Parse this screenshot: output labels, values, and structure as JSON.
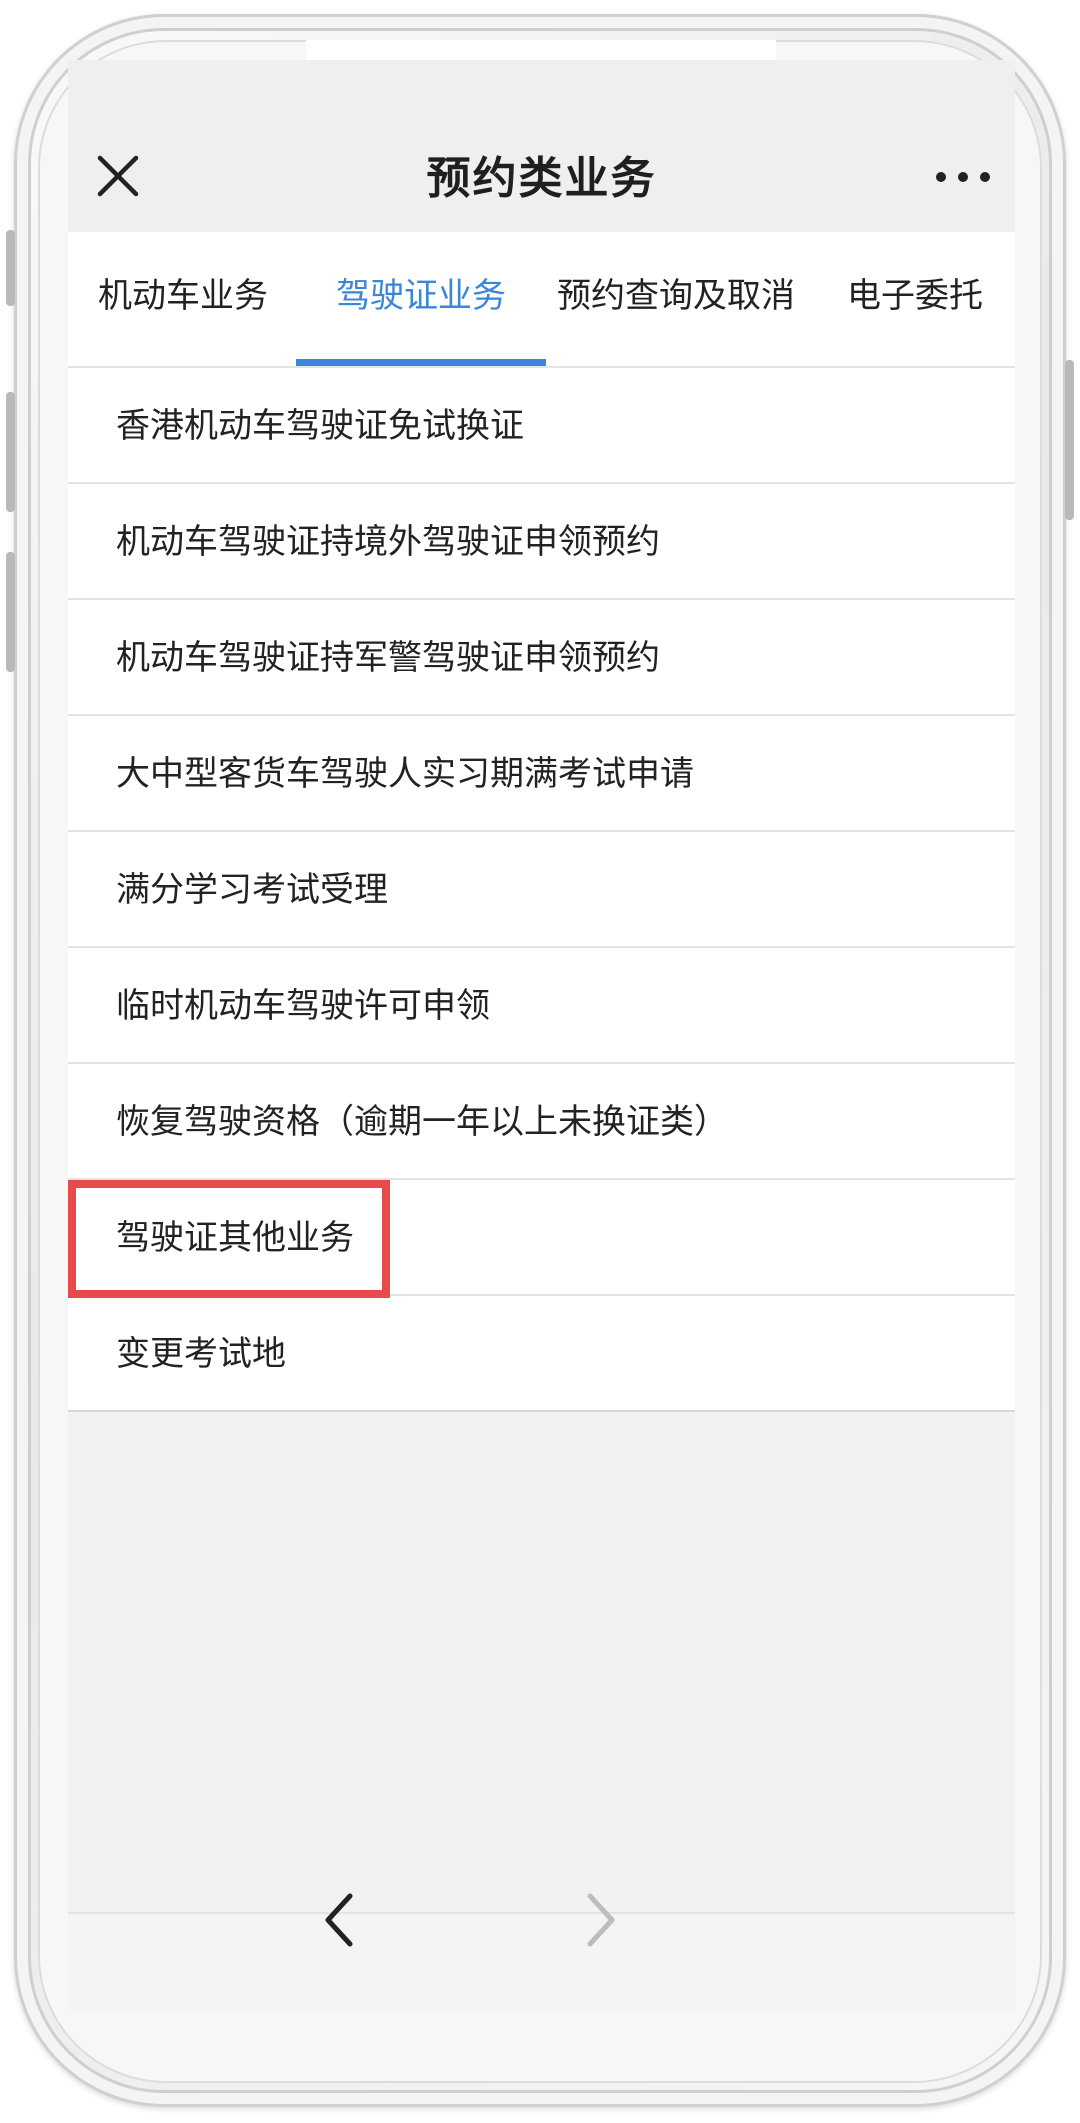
{
  "header": {
    "title": "预约类业务",
    "close_icon": "close-icon",
    "more_icon": "more-icon"
  },
  "tabs": [
    {
      "label": "机动车业务",
      "active": false
    },
    {
      "label": "驾驶证业务",
      "active": true
    },
    {
      "label": "预约查询及取消",
      "active": false
    },
    {
      "label": "电子委托",
      "active": false
    }
  ],
  "list": {
    "items": [
      {
        "label": "香港机动车驾驶证免试换证"
      },
      {
        "label": "机动车驾驶证持境外驾驶证申领预约"
      },
      {
        "label": "机动车驾驶证持军警驾驶证申领预约"
      },
      {
        "label": "大中型客货车驾驶人实习期满考试申请"
      },
      {
        "label": "满分学习考试受理"
      },
      {
        "label": "临时机动车驾驶许可申领"
      },
      {
        "label": "恢复驾驶资格（逾期一年以上未换证类）"
      },
      {
        "label": "驾驶证其他业务",
        "highlighted": true
      },
      {
        "label": "变更考试地"
      }
    ]
  },
  "bottom_nav": {
    "back_icon": "chevron-left-icon",
    "forward_icon": "chevron-right-icon"
  },
  "colors": {
    "accent": "#3a86d8",
    "highlight": "#e84a4a"
  }
}
